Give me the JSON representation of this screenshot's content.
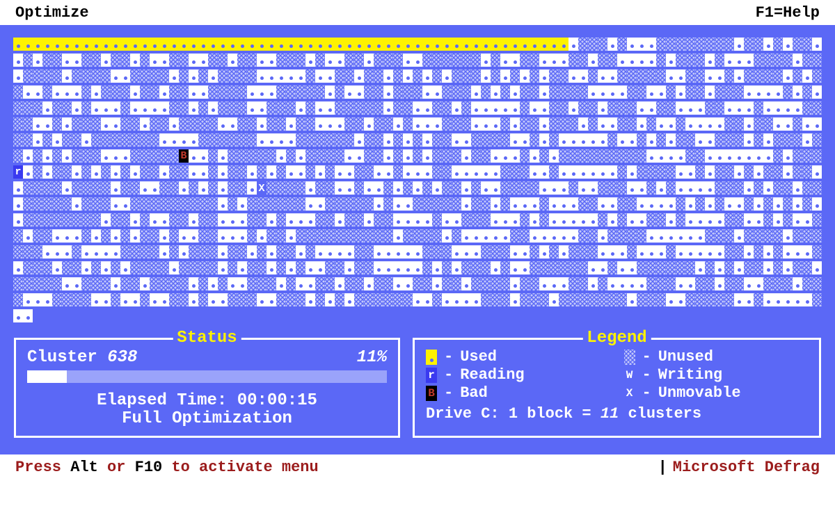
{
  "topbar": {
    "menu": "Optimize",
    "help": "F1=Help"
  },
  "map": {
    "cols": 83,
    "rows": 18,
    "optimized_cells": 57,
    "total_cells": 1494,
    "last_row_cells": 2,
    "reading_at": 664,
    "bad_at": 598,
    "unmovable_at": 772,
    "seed": 7
  },
  "status": {
    "title": "Status",
    "cluster_label": "Cluster",
    "cluster_value": "638",
    "percent": "11%",
    "progress_percent": 11,
    "elapsed_label": "Elapsed Time:",
    "elapsed_value": "00:00:15",
    "mode": "Full Optimization"
  },
  "legend": {
    "title": "Legend",
    "items": {
      "used": "Used",
      "unused": "Unused",
      "reading": "Reading",
      "writing": "Writing",
      "bad": "Bad",
      "unmovable": "Unmovable"
    },
    "drive_prefix": "Drive C: 1 block = ",
    "drive_value": "11",
    "drive_suffix": " clusters"
  },
  "bottombar": {
    "press": "Press ",
    "alt": "Alt",
    "or": " or ",
    "f10": "F10",
    "suffix": " to activate menu",
    "product": "Microsoft Defrag"
  }
}
